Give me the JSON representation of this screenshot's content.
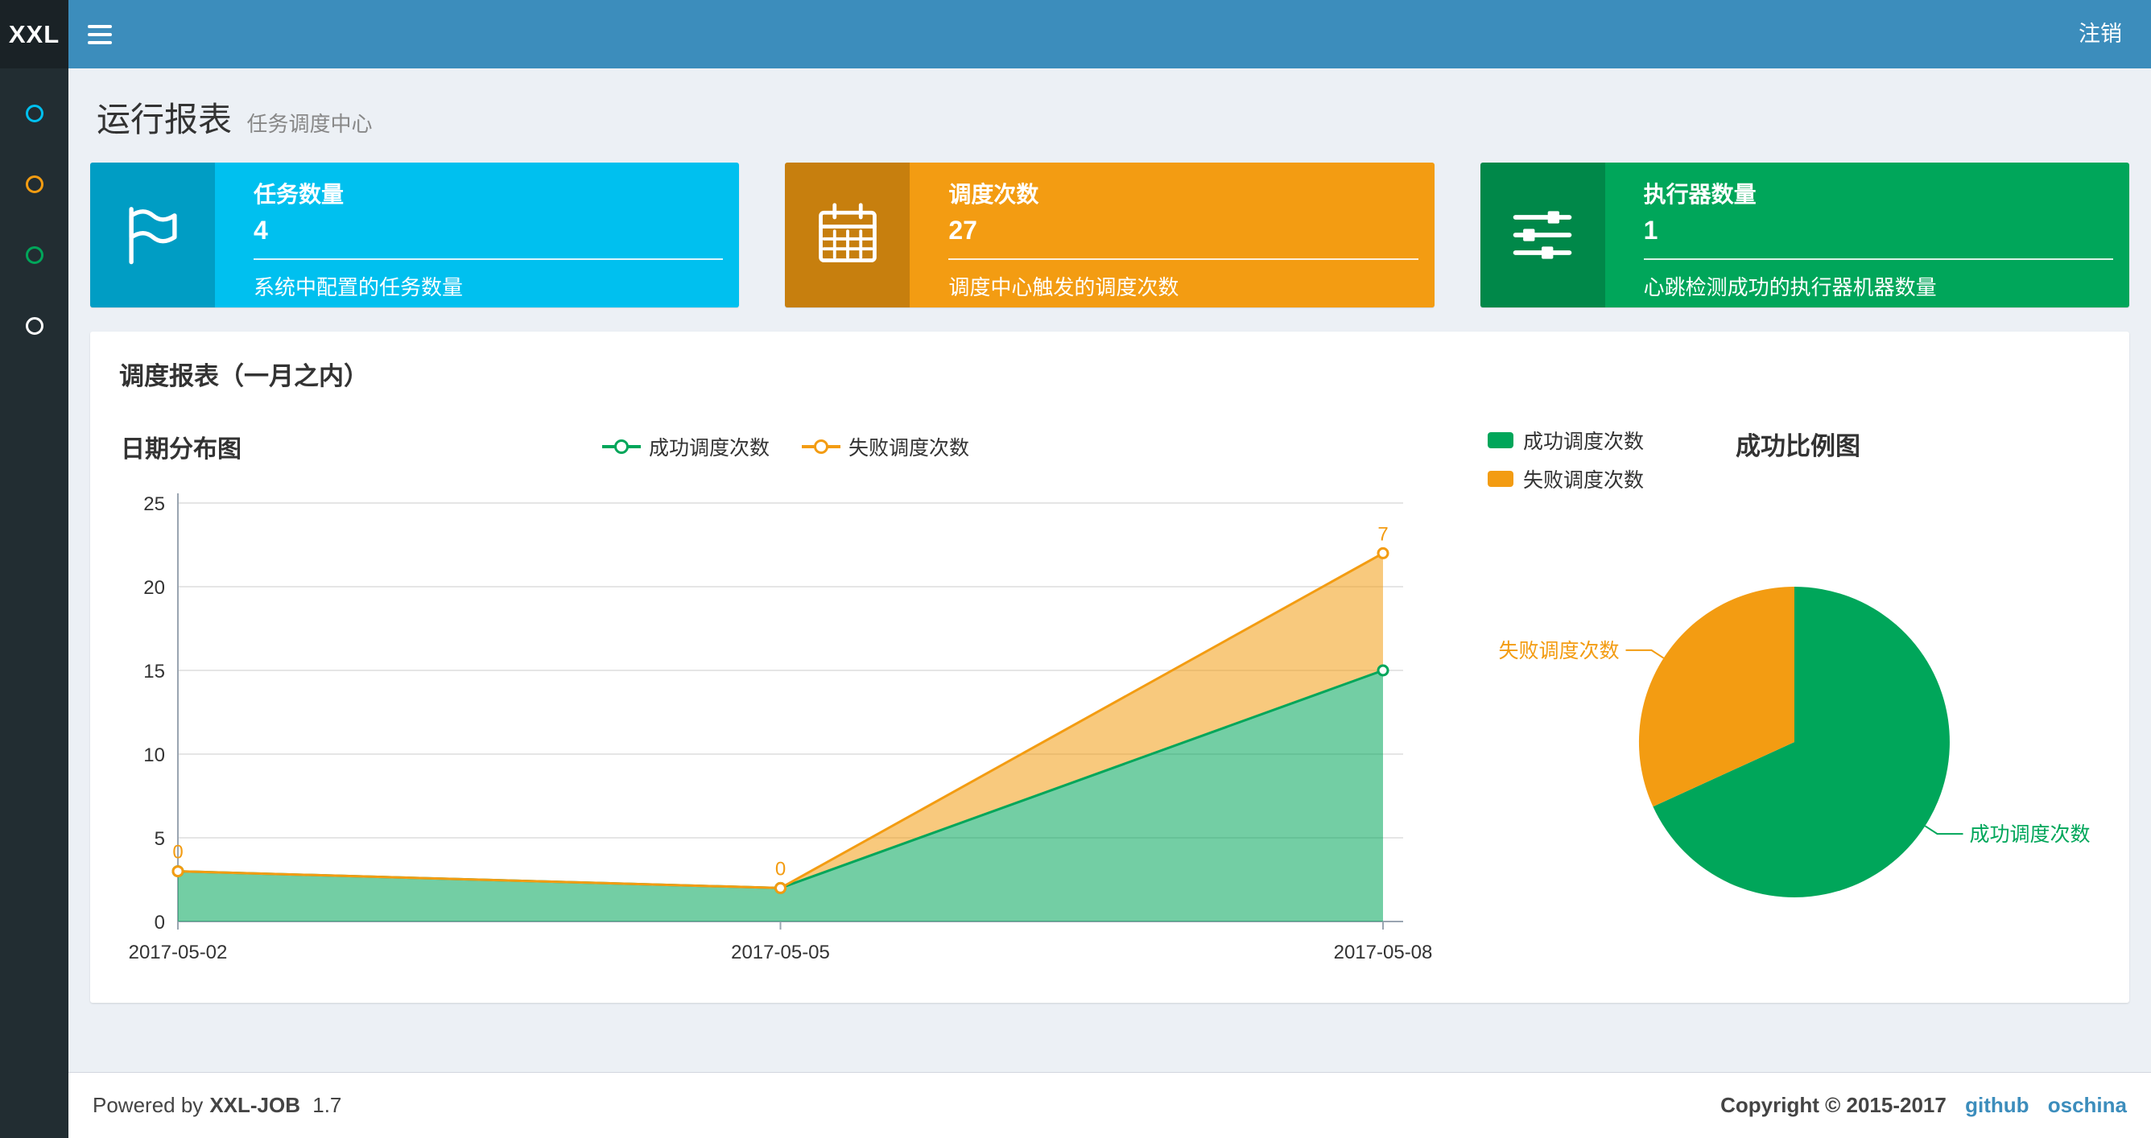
{
  "colors": {
    "navbar": "#3c8dbc",
    "logo_bg": "#1a2226",
    "sidebar": "#222d32",
    "page_bg": "#ecf0f5",
    "link": "#3c8dbc",
    "success": "#00a65a",
    "fail": "#f39c12",
    "info": "#00c0ef"
  },
  "navbar": {
    "logo": "XXL",
    "logout_label": "注销"
  },
  "sidebar": {
    "items": [
      {
        "id": "menu-item-1",
        "icon_color": "#00c0ef"
      },
      {
        "id": "menu-item-2",
        "icon_color": "#f39c12"
      },
      {
        "id": "menu-item-3",
        "icon_color": "#00a65a"
      },
      {
        "id": "menu-item-4",
        "icon_color": "#ffffff"
      }
    ]
  },
  "header": {
    "title": "运行报表",
    "subtitle": "任务调度中心"
  },
  "stat_boxes": [
    {
      "label": "任务数量",
      "value": "4",
      "desc": "系统中配置的任务数量",
      "bg": "#00c0ef",
      "icon": "flag-icon"
    },
    {
      "label": "调度次数",
      "value": "27",
      "desc": "调度中心触发的调度次数",
      "bg": "#f39c12",
      "icon": "calendar-icon"
    },
    {
      "label": "执行器数量",
      "value": "1",
      "desc": "心跳检测成功的执行器机器数量",
      "bg": "#00a65a",
      "icon": "sliders-icon"
    }
  ],
  "panel": {
    "title": "调度报表（一月之内）"
  },
  "chart_data": [
    {
      "type": "area",
      "title": "日期分布图",
      "stacked": true,
      "categories": [
        "2017-05-02",
        "2017-05-05",
        "2017-05-08"
      ],
      "series": [
        {
          "name": "成功调度次数",
          "color": "#00a65a",
          "values": [
            3,
            2,
            15
          ]
        },
        {
          "name": "失败调度次数",
          "color": "#f39c12",
          "values": [
            0,
            0,
            7
          ],
          "show_labels": true
        }
      ],
      "ylim": [
        0,
        25
      ],
      "yticks": [
        0,
        5,
        10,
        15,
        20,
        25
      ],
      "grid": true,
      "legend_position": "top-center"
    },
    {
      "type": "pie",
      "title": "成功比例图",
      "slices": [
        {
          "name": "成功调度次数",
          "value": 15,
          "color": "#00a65a"
        },
        {
          "name": "失败调度次数",
          "value": 7,
          "color": "#f39c12"
        }
      ],
      "legend_position": "top-left"
    }
  ],
  "footer": {
    "powered_prefix": "Powered by",
    "brand": "XXL-JOB",
    "version": "1.7",
    "copyright": "Copyright © 2015-2017",
    "links": [
      "github",
      "oschina"
    ]
  }
}
